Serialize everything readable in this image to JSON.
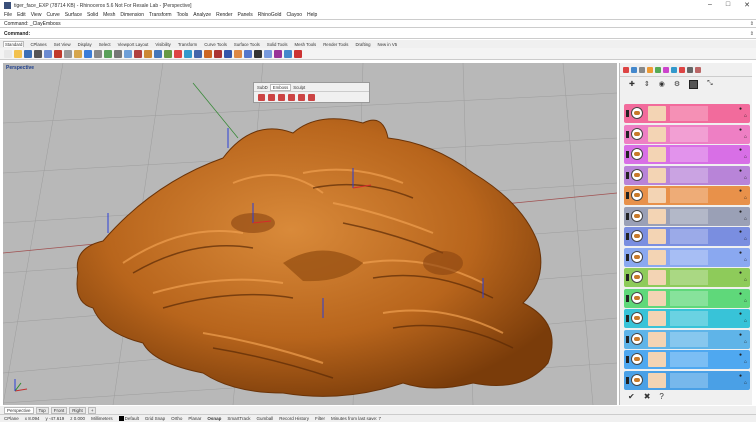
{
  "window": {
    "title": "tiger_face_EXP (78714 KB) - Rhinoceros 5.6 Not For Resale Lab - [Perspective]",
    "minimize": "–",
    "maximize": "□",
    "close": "✕"
  },
  "menu": [
    "File",
    "Edit",
    "View",
    "Curve",
    "Surface",
    "Solid",
    "Mesh",
    "Dimension",
    "Transform",
    "Tools",
    "Analyze",
    "Render",
    "Panels",
    "RhinoGold",
    "Clayoo",
    "Help"
  ],
  "command": {
    "history": "Command: _ClayEmboss",
    "prompt": "Command:"
  },
  "toolbar_tabs": [
    "Standard",
    "CPlanes",
    "Set View",
    "Display",
    "Select",
    "Viewport Layout",
    "Visibility",
    "Transform",
    "Curve Tools",
    "Surface Tools",
    "Solid Tools",
    "Mesh Tools",
    "Render Tools",
    "Drafting",
    "New in V5"
  ],
  "toolbar_icons": [
    "new-icon",
    "open-icon",
    "save-icon",
    "print-icon",
    "import-icon",
    "cut-icon",
    "copy-icon",
    "paste-icon",
    "undo-icon",
    "pan-icon",
    "rotate-icon",
    "zoom-icon",
    "zoom-window-icon",
    "zoom-extents-icon",
    "zoom-selected-icon",
    "select-icon",
    "grid-icon",
    "lights-icon",
    "point-icon",
    "curve-icon",
    "surface-icon",
    "solid-icon",
    "mesh-icon",
    "render-icon",
    "material-icon",
    "sphere-icon",
    "shaded-icon",
    "ghosted-icon",
    "xray-icon",
    "gumball-icon"
  ],
  "toolbar_colors": [
    "#e8e8e8",
    "#f2c14e",
    "#3b6fb6",
    "#555555",
    "#6b8bd1",
    "#c0392b",
    "#999999",
    "#d6a64d",
    "#3b7dd8",
    "#888888",
    "#5aa05a",
    "#777777",
    "#6e9fd8",
    "#b04040",
    "#cc8833",
    "#4477bb",
    "#669944",
    "#dd4444",
    "#3399cc",
    "#4466aa",
    "#cc6622",
    "#aa3333",
    "#3355aa",
    "#dd8844",
    "#5577cc",
    "#333333",
    "#7799dd",
    "#993399",
    "#4488cc",
    "#cc3333"
  ],
  "viewport": {
    "label": "Perspective",
    "background": "#b8b8b8",
    "model_color": "#c06a1a"
  },
  "emboss_panel": {
    "tabs": [
      "SubD",
      "Emboss",
      "Sculpt"
    ],
    "active_tab": "Emboss"
  },
  "side_panel": {
    "layers": [
      {
        "color": "#f26b9c"
      },
      {
        "color": "#ee7fc4"
      },
      {
        "color": "#d86fe6"
      },
      {
        "color": "#b884d8"
      },
      {
        "color": "#e8914a"
      },
      {
        "color": "#9aa0b6"
      },
      {
        "color": "#7a8ee0"
      },
      {
        "color": "#8aa8f0"
      },
      {
        "color": "#8ecb5a"
      },
      {
        "color": "#5fd87a"
      },
      {
        "color": "#38c3d8"
      },
      {
        "color": "#5fb4e8"
      },
      {
        "color": "#4fa8f0"
      },
      {
        "color": "#4aa0e6"
      }
    ]
  },
  "view_tabs": [
    "Perspective",
    "Top",
    "Front",
    "Right",
    "+"
  ],
  "status": {
    "cplane": "CPlane",
    "x": "x 8.094",
    "y": "y -47.619",
    "z": "z 0.000",
    "units": "Millimeters",
    "layer": "Default",
    "grid_snap": "Grid Snap",
    "ortho": "Ortho",
    "planar": "Planar",
    "osnap": "Osnap",
    "smarttrack": "SmartTrack",
    "gumball": "Gumball",
    "record_history": "Record History",
    "filter": "Filter",
    "autosave": "Minutes from last save: 7"
  }
}
